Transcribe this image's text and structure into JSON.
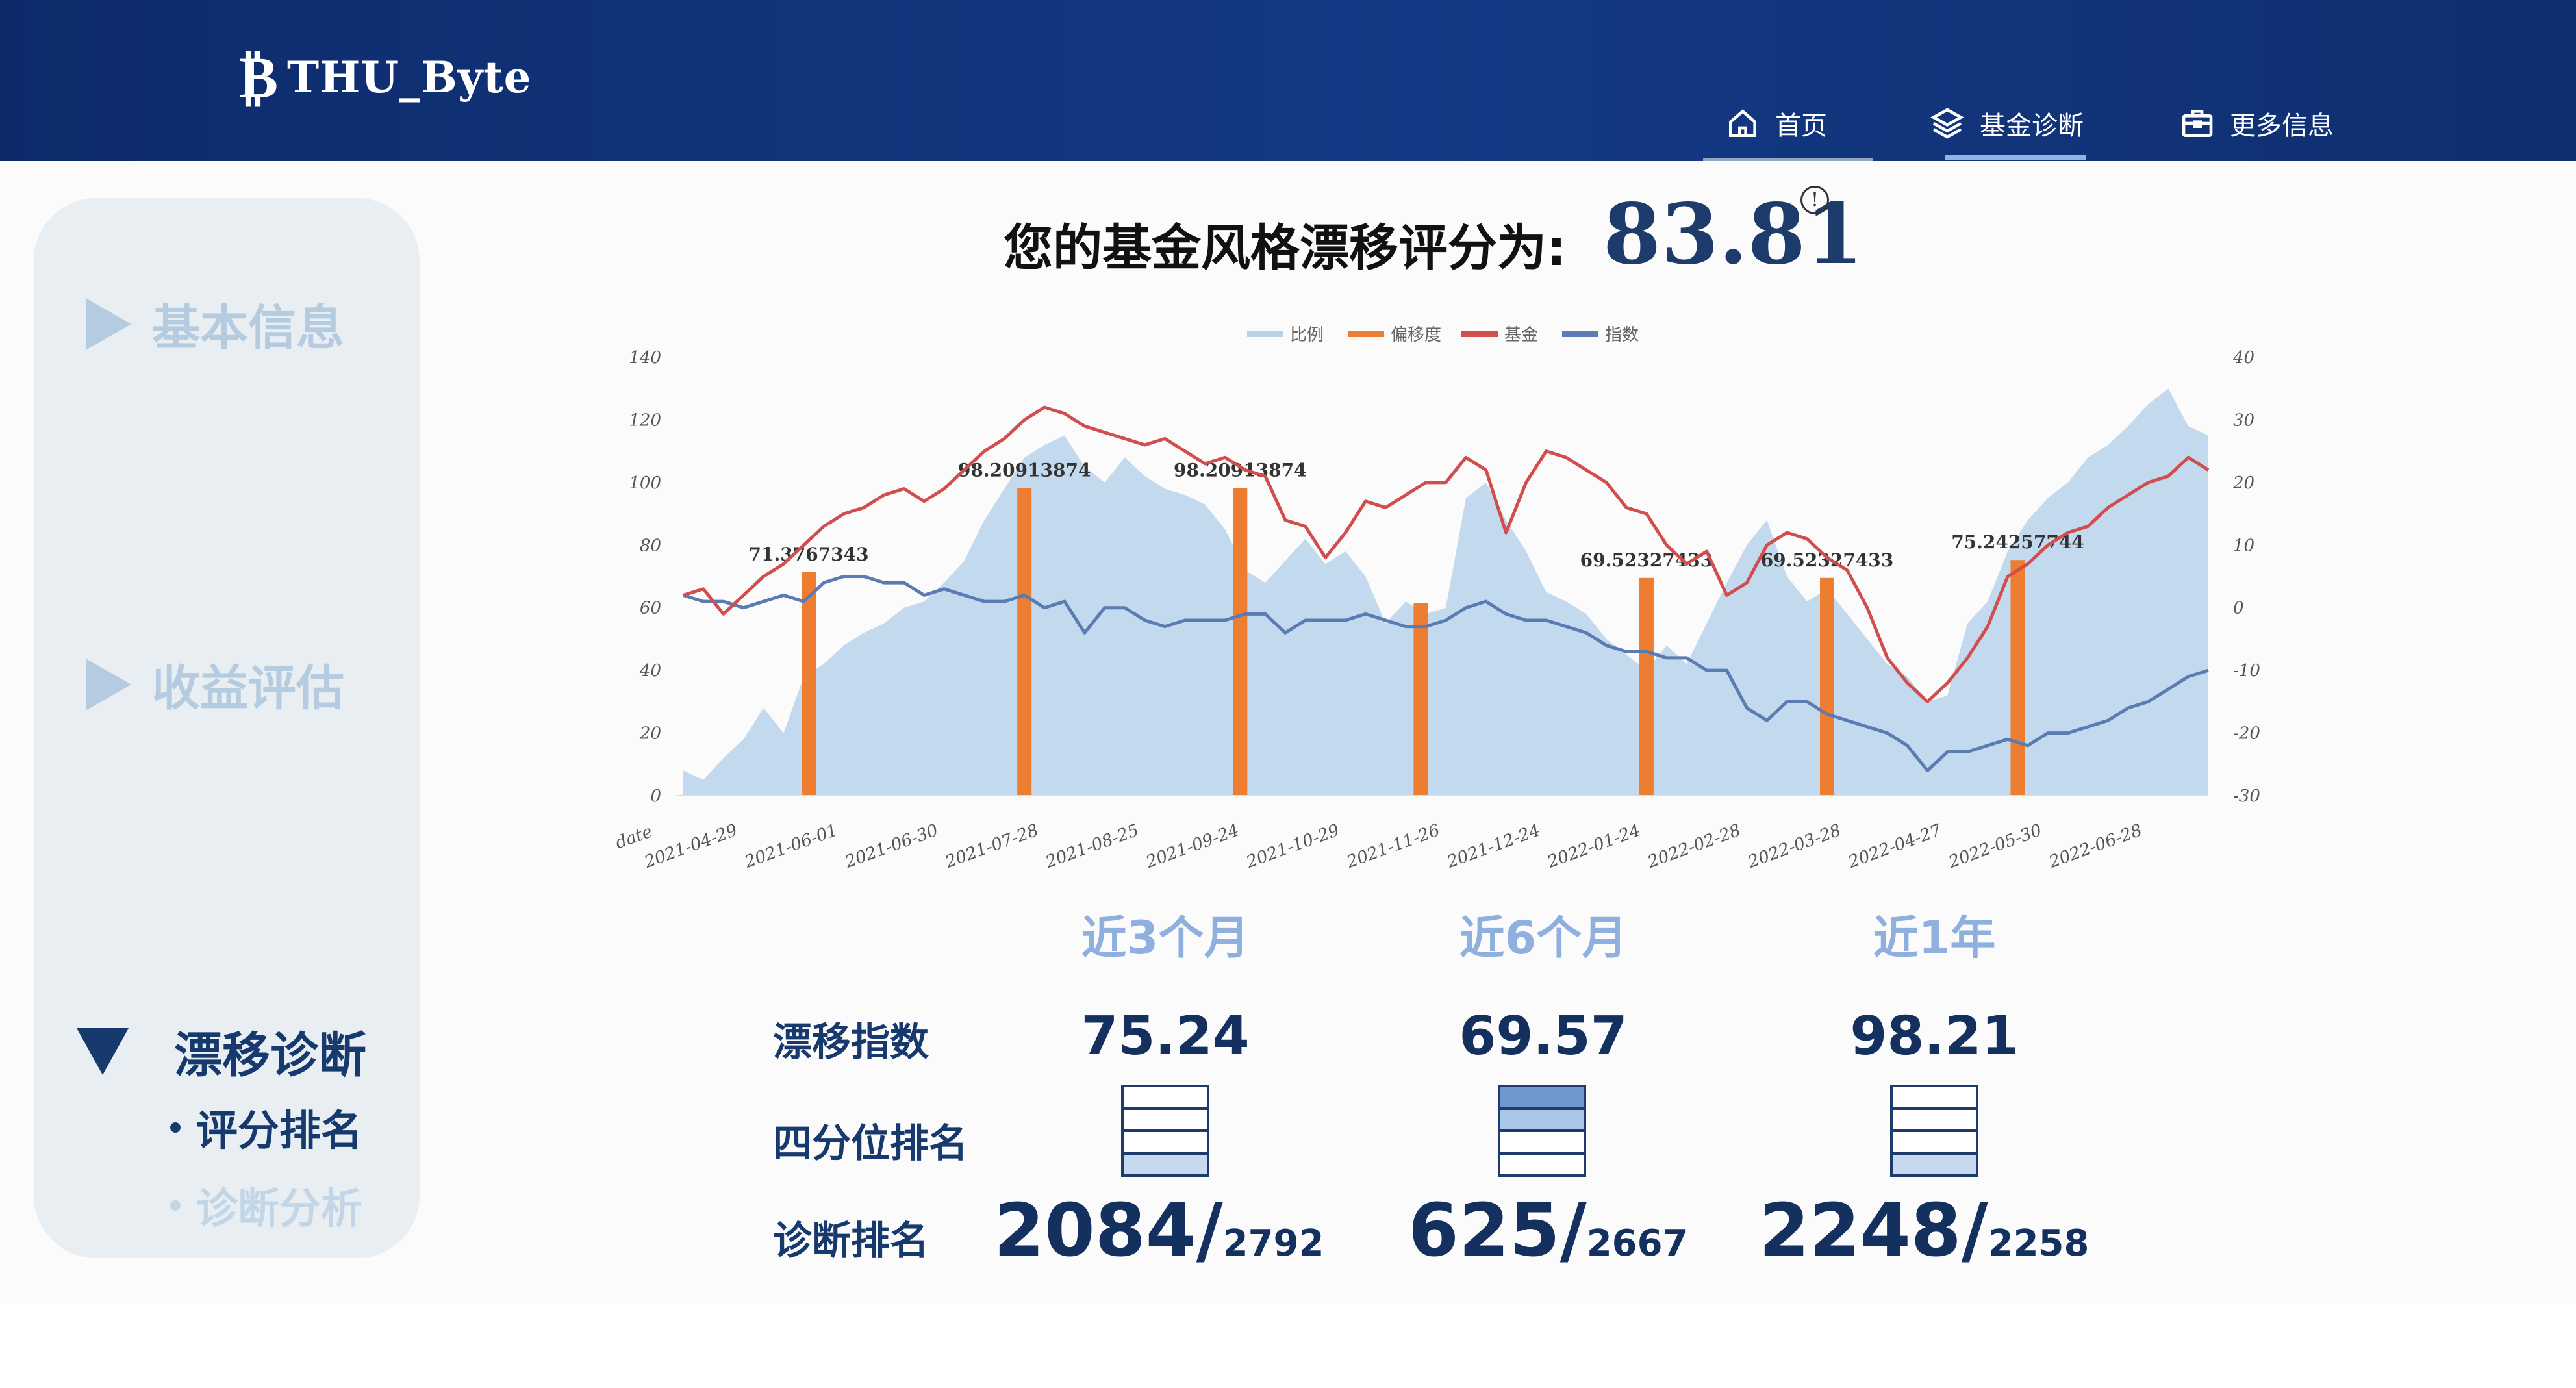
{
  "header": {
    "logo_mark": "₿",
    "logo_text": "THU_Byte",
    "nav": [
      {
        "label": "首页",
        "icon": "home-icon"
      },
      {
        "label": "基金诊断",
        "icon": "layers-icon"
      },
      {
        "label": "更多信息",
        "icon": "briefcase-icon"
      }
    ]
  },
  "sidebar": {
    "items": [
      {
        "label": "基本信息"
      },
      {
        "label": "收益评估"
      },
      {
        "label": "漂移诊断"
      }
    ],
    "subitems": [
      {
        "label": "评分排名"
      },
      {
        "label": "诊断分析"
      }
    ]
  },
  "score": {
    "title": "您的基金风格漂移评分为:",
    "value": "83.81",
    "info_icon": "!"
  },
  "chart_data": {
    "type": "line",
    "legend": [
      "比例",
      "偏移度",
      "基金",
      "指数"
    ],
    "legend_position": "top-center",
    "xlabel": "date",
    "x_ticks": [
      "2021-04-29",
      "2021-06-01",
      "2021-06-30",
      "2021-07-28",
      "2021-08-25",
      "2021-09-24",
      "2021-10-29",
      "2021-11-26",
      "2021-12-24",
      "2022-01-24",
      "2022-02-28",
      "2022-03-28",
      "2022-04-27",
      "2022-05-30",
      "2022-06-28"
    ],
    "y_left": {
      "min": 0,
      "max": 140,
      "ticks": [
        0,
        20,
        40,
        60,
        80,
        100,
        120,
        140
      ]
    },
    "y_right": {
      "min": -30,
      "max": 40,
      "ticks": [
        -30,
        -20,
        -10,
        0,
        10,
        20,
        30,
        40
      ]
    },
    "grid": false,
    "colors": {
      "ratio": "#b9d2ea",
      "drift": "#ed7d31",
      "fund": "#d14e4f",
      "index": "#5b7bb3"
    },
    "series": [
      {
        "name": "偏移度",
        "type": "bar",
        "points": [
          {
            "x": 1.25,
            "y": 71.3767343,
            "label": "71.3767343"
          },
          {
            "x": 3.4,
            "y": 98.20913874,
            "label": "98.20913874"
          },
          {
            "x": 5.55,
            "y": 98.20913874,
            "label": "98.20913874"
          },
          {
            "x": 7.35,
            "y": 61.5,
            "label": ""
          },
          {
            "x": 9.6,
            "y": 69.52327433,
            "label": "69.52327433"
          },
          {
            "x": 11.4,
            "y": 69.52327433,
            "label": "69.52327433"
          },
          {
            "x": 13.3,
            "y": 75.24257744,
            "label": "75.24257744"
          }
        ]
      },
      {
        "name": "比例",
        "type": "area",
        "axis": "left",
        "x": [
          0,
          0.2,
          0.4,
          0.6,
          0.8,
          1.0,
          1.2,
          1.4,
          1.6,
          1.8,
          2.0,
          2.2,
          2.4,
          2.6,
          2.8,
          3.0,
          3.2,
          3.4,
          3.6,
          3.8,
          4.0,
          4.2,
          4.4,
          4.6,
          4.8,
          5.0,
          5.2,
          5.4,
          5.6,
          5.8,
          6.0,
          6.2,
          6.4,
          6.6,
          6.8,
          7.0,
          7.2,
          7.4,
          7.6,
          7.8,
          8.0,
          8.2,
          8.4,
          8.6,
          8.8,
          9.0,
          9.2,
          9.4,
          9.6,
          9.8,
          10.0,
          10.2,
          10.4,
          10.6,
          10.8,
          11.0,
          11.2,
          11.4,
          11.6,
          11.8,
          12.0,
          12.2,
          12.4,
          12.6,
          12.8,
          13.0,
          13.2,
          13.4,
          13.6,
          13.8,
          14.0,
          14.2,
          14.4,
          14.6,
          14.8,
          15.0,
          15.2
        ],
        "y": [
          8,
          5,
          12,
          18,
          28,
          20,
          38,
          42,
          48,
          52,
          55,
          60,
          62,
          68,
          75,
          88,
          98,
          108,
          112,
          115,
          105,
          100,
          108,
          102,
          98,
          96,
          93,
          85,
          72,
          68,
          75,
          82,
          74,
          78,
          70,
          55,
          62,
          58,
          60,
          95,
          100,
          88,
          78,
          65,
          62,
          58,
          50,
          45,
          40,
          48,
          42,
          55,
          68,
          80,
          88,
          70,
          62,
          66,
          58,
          50,
          42,
          38,
          30,
          32,
          55,
          62,
          78,
          88,
          95,
          100,
          108,
          112,
          118,
          125,
          130,
          118,
          115
        ]
      },
      {
        "name": "基金",
        "type": "line",
        "axis": "right",
        "x": [
          0,
          0.2,
          0.4,
          0.6,
          0.8,
          1.0,
          1.2,
          1.4,
          1.6,
          1.8,
          2.0,
          2.2,
          2.4,
          2.6,
          2.8,
          3.0,
          3.2,
          3.4,
          3.6,
          3.8,
          4.0,
          4.2,
          4.4,
          4.6,
          4.8,
          5.0,
          5.2,
          5.4,
          5.6,
          5.8,
          6.0,
          6.2,
          6.4,
          6.6,
          6.8,
          7.0,
          7.2,
          7.4,
          7.6,
          7.8,
          8.0,
          8.2,
          8.4,
          8.6,
          8.8,
          9.0,
          9.2,
          9.4,
          9.6,
          9.8,
          10.0,
          10.2,
          10.4,
          10.6,
          10.8,
          11.0,
          11.2,
          11.4,
          11.6,
          11.8,
          12.0,
          12.2,
          12.4,
          12.6,
          12.8,
          13.0,
          13.2,
          13.4,
          13.6,
          13.8,
          14.0,
          14.2,
          14.4,
          14.6,
          14.8,
          15.0,
          15.2
        ],
        "y": [
          2,
          3,
          -1,
          2,
          5,
          7,
          10,
          13,
          15,
          16,
          18,
          19,
          17,
          19,
          22,
          25,
          27,
          30,
          32,
          31,
          29,
          28,
          27,
          26,
          27,
          25,
          23,
          24,
          22,
          21,
          14,
          13,
          8,
          12,
          17,
          16,
          18,
          20,
          20,
          24,
          22,
          12,
          20,
          25,
          24,
          22,
          20,
          16,
          15,
          10,
          7,
          9,
          2,
          4,
          10,
          12,
          11,
          8,
          6,
          0,
          -8,
          -12,
          -15,
          -12,
          -8,
          -3,
          5,
          7,
          10,
          12,
          13,
          16,
          18,
          20,
          21,
          24,
          22
        ]
      },
      {
        "name": "指数",
        "type": "line",
        "axis": "right",
        "x": [
          0,
          0.2,
          0.4,
          0.6,
          0.8,
          1.0,
          1.2,
          1.4,
          1.6,
          1.8,
          2.0,
          2.2,
          2.4,
          2.6,
          2.8,
          3.0,
          3.2,
          3.4,
          3.6,
          3.8,
          4.0,
          4.2,
          4.4,
          4.6,
          4.8,
          5.0,
          5.2,
          5.4,
          5.6,
          5.8,
          6.0,
          6.2,
          6.4,
          6.6,
          6.8,
          7.0,
          7.2,
          7.4,
          7.6,
          7.8,
          8.0,
          8.2,
          8.4,
          8.6,
          8.8,
          9.0,
          9.2,
          9.4,
          9.6,
          9.8,
          10.0,
          10.2,
          10.4,
          10.6,
          10.8,
          11.0,
          11.2,
          11.4,
          11.6,
          11.8,
          12.0,
          12.2,
          12.4,
          12.6,
          12.8,
          13.0,
          13.2,
          13.4,
          13.6,
          13.8,
          14.0,
          14.2,
          14.4,
          14.6,
          14.8,
          15.0,
          15.2
        ],
        "y": [
          2,
          1,
          1,
          0,
          1,
          2,
          1,
          4,
          5,
          5,
          4,
          4,
          2,
          3,
          2,
          1,
          1,
          2,
          0,
          1,
          -4,
          0,
          0,
          -2,
          -3,
          -2,
          -2,
          -2,
          -1,
          -1,
          -4,
          -2,
          -2,
          -2,
          -1,
          -2,
          -3,
          -3,
          -2,
          0,
          1,
          -1,
          -2,
          -2,
          -3,
          -4,
          -6,
          -7,
          -7,
          -8,
          -8,
          -10,
          -10,
          -16,
          -18,
          -15,
          -15,
          -17,
          -18,
          -19,
          -20,
          -22,
          -26,
          -23,
          -23,
          -22,
          -21,
          -22,
          -20,
          -20,
          -19,
          -18,
          -16,
          -15,
          -13,
          -11,
          -10
        ]
      }
    ]
  },
  "stats": {
    "columns": [
      "近3个月",
      "近6个月",
      "近1年"
    ],
    "row_labels": [
      "漂移指数",
      "四分位排名",
      "诊断排名"
    ],
    "drift_index": [
      "75.24",
      "69.57",
      "98.21"
    ],
    "quartile_highlight": [
      4,
      2,
      4
    ],
    "rank": [
      {
        "rank": "2084/",
        "total": "2792"
      },
      {
        "rank": "625/",
        "total": "2667"
      },
      {
        "rank": "2248/",
        "total": "2258"
      }
    ]
  }
}
